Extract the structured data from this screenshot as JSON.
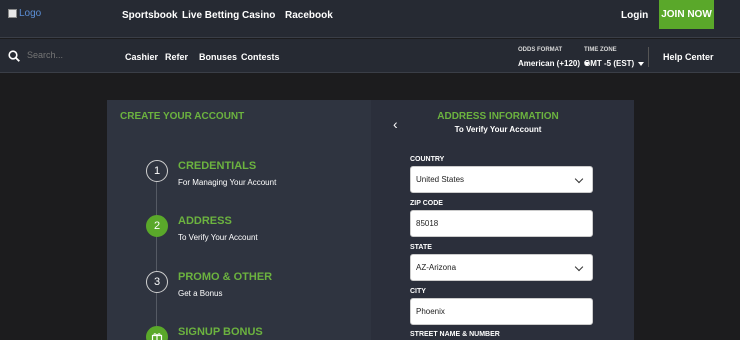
{
  "header": {
    "logo_alt": "Logo",
    "nav": [
      "Sportsbook",
      "Live Betting",
      "Casino",
      "Racebook"
    ],
    "login": "Login",
    "join": "JOIN NOW"
  },
  "subbar": {
    "search_placeholder": "Search...",
    "links": [
      "Cashier",
      "Refer",
      "Bonuses",
      "Contests"
    ],
    "odds_label": "ODDS FORMAT",
    "odds_value": "American (+120)",
    "tz_label": "TIME ZONE",
    "tz_value": "GMT -5 (EST)",
    "help": "Help Center"
  },
  "signup": {
    "title": "CREATE YOUR ACCOUNT",
    "steps": [
      {
        "num": "1",
        "title": "CREDENTIALS",
        "sub": "For Managing Your Account"
      },
      {
        "num": "2",
        "title": "ADDRESS",
        "sub": "To Verify Your Account"
      },
      {
        "num": "3",
        "title": "PROMO & OTHER",
        "sub": "Get a Bonus"
      },
      {
        "num": "",
        "title": "SIGNUP BONUS",
        "sub": ""
      }
    ],
    "form_title": "ADDRESS INFORMATION",
    "form_sub": "To Verify Your Account",
    "fields": {
      "country_label": "COUNTRY",
      "country_value": "United States",
      "zip_label": "ZIP CODE",
      "zip_value": "85018",
      "state_label": "STATE",
      "state_value": "AZ-Arizona",
      "city_label": "CITY",
      "city_value": "Phoenix",
      "street_label": "STREET NAME & NUMBER"
    }
  },
  "colors": {
    "accent": "#5aa82a",
    "accent_text": "#6cb33f",
    "bg": "#1c1c1e",
    "bar": "#262a33"
  }
}
